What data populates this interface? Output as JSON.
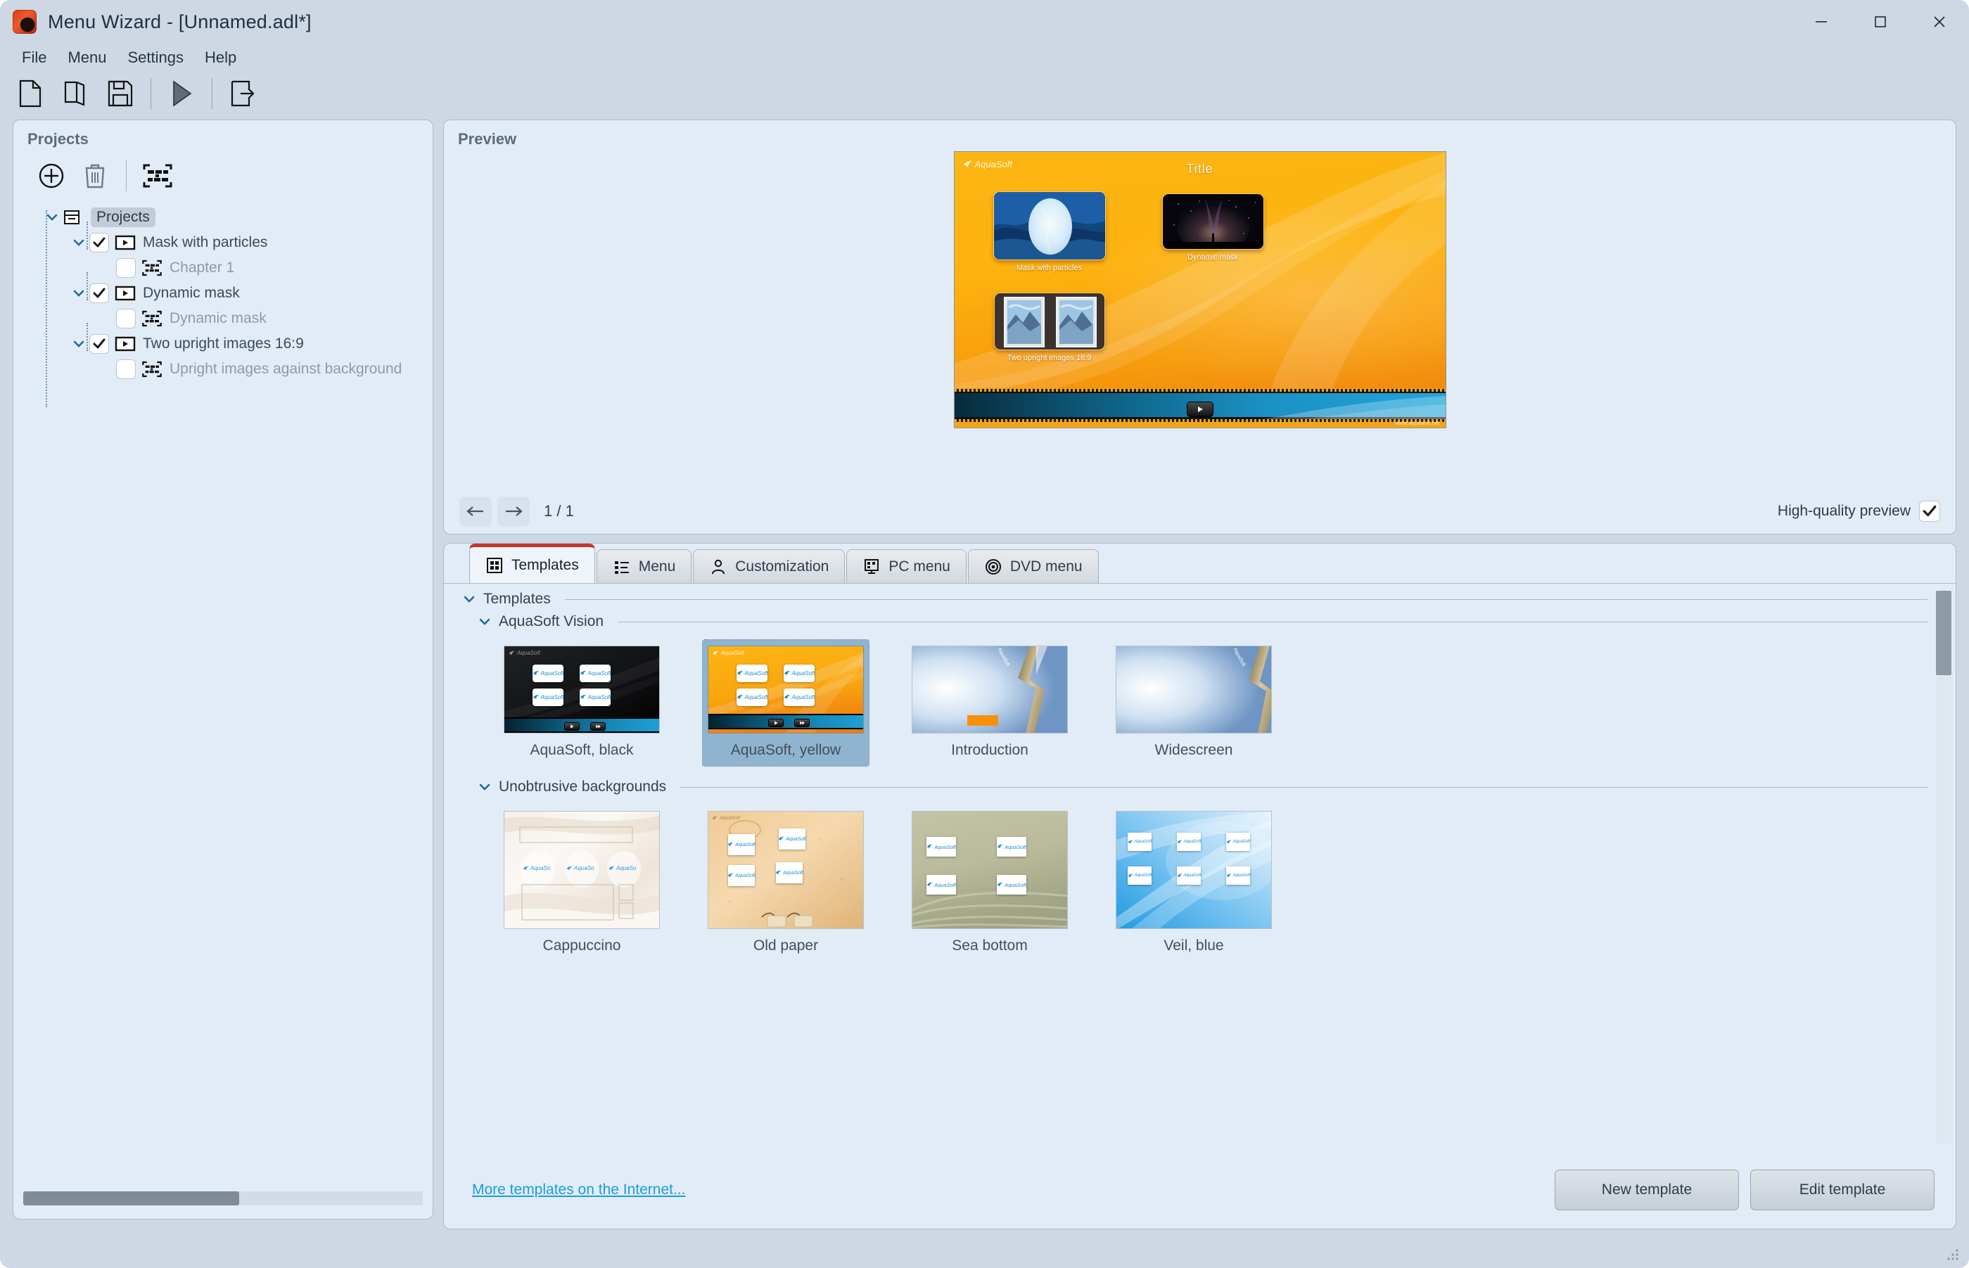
{
  "window": {
    "title": "Menu Wizard - [Unnamed.adl*]",
    "app_icon": "aquasoft-app-icon",
    "controls": {
      "minimize": "minimize-icon",
      "maximize": "maximize-icon",
      "close": "close-icon"
    }
  },
  "menubar": {
    "items": [
      "File",
      "Menu",
      "Settings",
      "Help"
    ]
  },
  "toolbar": {
    "buttons": [
      {
        "name": "new-file-icon",
        "label": "New"
      },
      {
        "name": "open-file-icon",
        "label": "Open"
      },
      {
        "name": "save-icon",
        "label": "Save"
      },
      {
        "name": "play-icon",
        "label": "Play"
      },
      {
        "name": "export-icon",
        "label": "Export"
      }
    ]
  },
  "projects": {
    "caption": "Projects",
    "toolbar": [
      {
        "name": "add-project-icon",
        "label": "Add"
      },
      {
        "name": "delete-project-icon",
        "label": "Delete"
      },
      {
        "name": "chapter-icon",
        "label": "Chapter"
      }
    ],
    "tree": [
      {
        "level": 0,
        "label": "Projects",
        "icon": "folder-node-icon",
        "selected": true,
        "has_checkbox": false,
        "expanded": true,
        "dim": false
      },
      {
        "level": 1,
        "label": "Mask with particles",
        "icon": "movie-icon",
        "checked": true,
        "expanded": true,
        "dim": false
      },
      {
        "level": 2,
        "label": "Chapter 1",
        "icon": "chapter-icon",
        "checked": false,
        "dim": true
      },
      {
        "level": 1,
        "label": "Dynamic mask",
        "icon": "movie-icon",
        "checked": true,
        "expanded": true,
        "dim": false
      },
      {
        "level": 2,
        "label": "Dynamic mask",
        "icon": "chapter-icon",
        "checked": false,
        "dim": true
      },
      {
        "level": 1,
        "label": "Two upright images 16:9",
        "icon": "movie-icon",
        "checked": true,
        "expanded": true,
        "dim": false
      },
      {
        "level": 2,
        "label": "Upright images against background",
        "icon": "chapter-icon",
        "checked": false,
        "dim": true
      }
    ]
  },
  "preview": {
    "caption": "Preview",
    "menu_screen": {
      "title": "Title",
      "brand": "AquaSoft",
      "url": "www.aquasoft.net",
      "items": [
        {
          "caption": "Mask with particles",
          "thumb": "ocean-oval-mask"
        },
        {
          "caption": "Dynamic mask",
          "thumb": "night-sky"
        },
        {
          "caption": "Two upright images 16:9",
          "thumb": "two-upright-mountains"
        }
      ]
    },
    "nav": {
      "prev": "arrow-left-icon",
      "next": "arrow-right-icon",
      "page": "1 / 1"
    },
    "high_quality": {
      "label": "High-quality preview",
      "checked": true
    }
  },
  "tabs": [
    {
      "label": "Templates",
      "icon": "grid-icon",
      "active": true
    },
    {
      "label": "Menu",
      "icon": "list-icon",
      "active": false
    },
    {
      "label": "Customization",
      "icon": "person-icon",
      "active": false
    },
    {
      "label": "PC menu",
      "icon": "monitor-icon",
      "active": false
    },
    {
      "label": "DVD menu",
      "icon": "disc-icon",
      "active": false
    }
  ],
  "templates_tab": {
    "section_title": "Templates",
    "groups": [
      {
        "title": "AquaSoft Vision",
        "items": [
          {
            "name": "AquaSoft, black",
            "style": "aquasoft-black",
            "selected": false
          },
          {
            "name": "AquaSoft, yellow",
            "style": "aquasoft-yellow",
            "selected": true
          },
          {
            "name": "Introduction",
            "style": "introduction",
            "selected": false
          },
          {
            "name": "Widescreen",
            "style": "widescreen",
            "selected": false
          }
        ]
      },
      {
        "title": "Unobtrusive backgrounds",
        "items": [
          {
            "name": "Cappuccino",
            "style": "cappuccino",
            "selected": false
          },
          {
            "name": "Old paper",
            "style": "old-paper",
            "selected": false
          },
          {
            "name": "Sea bottom",
            "style": "sea-bottom",
            "selected": false
          },
          {
            "name": "Veil, blue",
            "style": "veil-blue",
            "selected": false
          }
        ]
      }
    ],
    "more_link": "More templates on the Internet...",
    "buttons": {
      "new": "New template",
      "edit": "Edit template"
    }
  },
  "colors": {
    "panel_bg": "#e2ecf7",
    "window_chrome": "#cdd8e4",
    "active_tab_accent": "#c0392b",
    "selection": "#8fb4cf",
    "link": "#1a9cdc",
    "menu_yellow": "#fcb614",
    "aqua_blue": "#1b8ed4"
  }
}
